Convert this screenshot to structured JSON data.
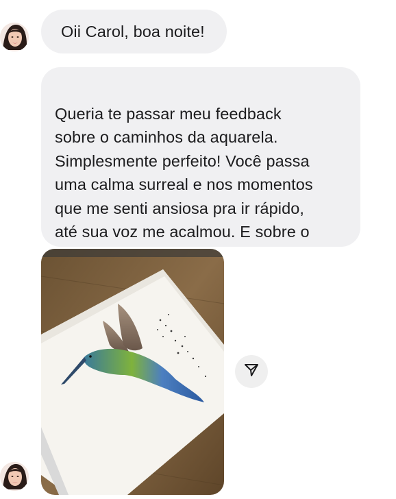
{
  "chat": {
    "messages": [
      {
        "text": "Oii Carol, boa noite!"
      },
      {
        "text": "Queria te passar meu feedback\nsobre o caminhos da aquarela.\nSimplesmente perfeito! Você passa\numa calma surreal e nos momentos\nque me senti ansiosa pra ir rápido,\naté sua voz me acalmou. E sobre o\nresultado..."
      }
    ],
    "photo": {
      "subject": "hummingbird-watercolor-painting"
    },
    "icons": {
      "avatar": "sender-avatar",
      "share": "send-arrow-icon"
    }
  },
  "colors": {
    "bubble_bg": "#f0f0f2",
    "text": "#1c1c1e",
    "share_bg": "#efefef"
  }
}
